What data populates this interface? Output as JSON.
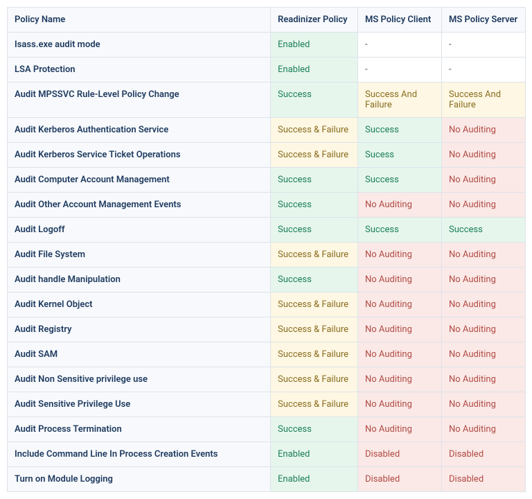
{
  "headers": [
    "Policy Name",
    "Readinizer Policy",
    "MS Policy Client",
    "MS Policy Server"
  ],
  "statusClass": {
    "Enabled": "s-green",
    "Disabled": "s-red",
    "Success": "s-green",
    "Success & Failure": "s-yellow",
    "Success And Failure": "s-yellow",
    "Sucess": "s-green",
    "No Auditing": "s-red",
    "-": "s-plain"
  },
  "rows": [
    {
      "name": "Isass.exe audit mode",
      "readinizer": "Enabled",
      "client": "-",
      "server": "-"
    },
    {
      "name": "LSA Protection",
      "readinizer": "Enabled",
      "client": "-",
      "server": "-"
    },
    {
      "name": "Audit MPSSVC Rule-Level Policy Change",
      "readinizer": "Success",
      "client": "Success And Failure",
      "server": "Success And Failure"
    },
    {
      "name": "Audit Kerberos Authentication Service",
      "readinizer": "Success & Failure",
      "client": "Success",
      "server": "No Auditing"
    },
    {
      "name": "Audit Kerberos Service Ticket Operations",
      "readinizer": "Success & Failure",
      "client": "Sucess",
      "server": "No Auditing"
    },
    {
      "name": "Audit Computer Account Management",
      "readinizer": "Success",
      "client": "Success",
      "server": "No Auditing"
    },
    {
      "name": "Audit Other Account Management Events",
      "readinizer": "Success",
      "client": "No Auditing",
      "server": "No Auditing"
    },
    {
      "name": "Audit Logoff",
      "readinizer": "Success",
      "client": "Success",
      "server": "Success"
    },
    {
      "name": "Audit File System",
      "readinizer": "Success & Failure",
      "client": "No Auditing",
      "server": "No Auditing"
    },
    {
      "name": "Audit handle Manipulation",
      "readinizer": "Success",
      "client": "No Auditing",
      "server": "No Auditing"
    },
    {
      "name": "Audit Kernel Object",
      "readinizer": "Success & Failure",
      "client": "No Auditing",
      "server": "No Auditing"
    },
    {
      "name": "Audit Registry",
      "readinizer": "Success & Failure",
      "client": "No Auditing",
      "server": "No Auditing"
    },
    {
      "name": "Audit SAM",
      "readinizer": "Success & Failure",
      "client": "No Auditing",
      "server": "No Auditing"
    },
    {
      "name": "Audit Non Sensitive privilege use",
      "readinizer": "Success & Failure",
      "client": "No Auditing",
      "server": "No Auditing"
    },
    {
      "name": "Audit Sensitive Privilege Use",
      "readinizer": "Success & Failure",
      "client": "No Auditing",
      "server": "No Auditing"
    },
    {
      "name": "Audit Process Termination",
      "readinizer": "Success",
      "client": "No Auditing",
      "server": "No Auditing"
    },
    {
      "name": "Include Command Line In Process Creation Events",
      "readinizer": "Enabled",
      "client": "Disabled",
      "server": "Disabled"
    },
    {
      "name": "Turn on Module Logging",
      "readinizer": "Enabled",
      "client": "Disabled",
      "server": "Disabled"
    }
  ]
}
